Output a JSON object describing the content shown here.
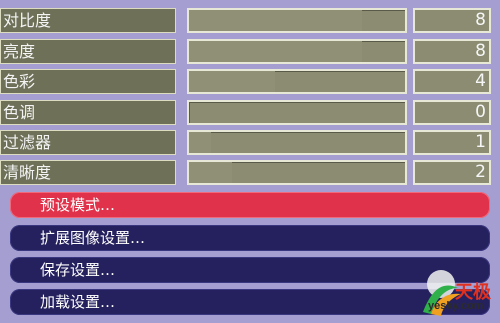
{
  "settings": [
    {
      "label": "对比度",
      "value": "8",
      "level": 0.8
    },
    {
      "label": "亮度",
      "value": "8",
      "level": 0.8
    },
    {
      "label": "色彩",
      "value": "4",
      "level": 0.4
    },
    {
      "label": "色调",
      "value": "0",
      "level": 0.0
    },
    {
      "label": "过滤器",
      "value": "1",
      "level": 0.1
    },
    {
      "label": "清晰度",
      "value": "2",
      "level": 0.2
    }
  ],
  "menu": [
    {
      "label": "预设模式…",
      "state": "active"
    },
    {
      "label": "扩展图像设置…",
      "state": "normal"
    },
    {
      "label": "保存设置…",
      "state": "normal"
    },
    {
      "label": "加载设置…",
      "state": "normal"
    }
  ],
  "watermark": {
    "brand": "天极",
    "site": "yesky.com"
  },
  "colors": {
    "menu_active": "#e0324a",
    "menu_normal": "#25215e",
    "background": "#a49fd0"
  }
}
